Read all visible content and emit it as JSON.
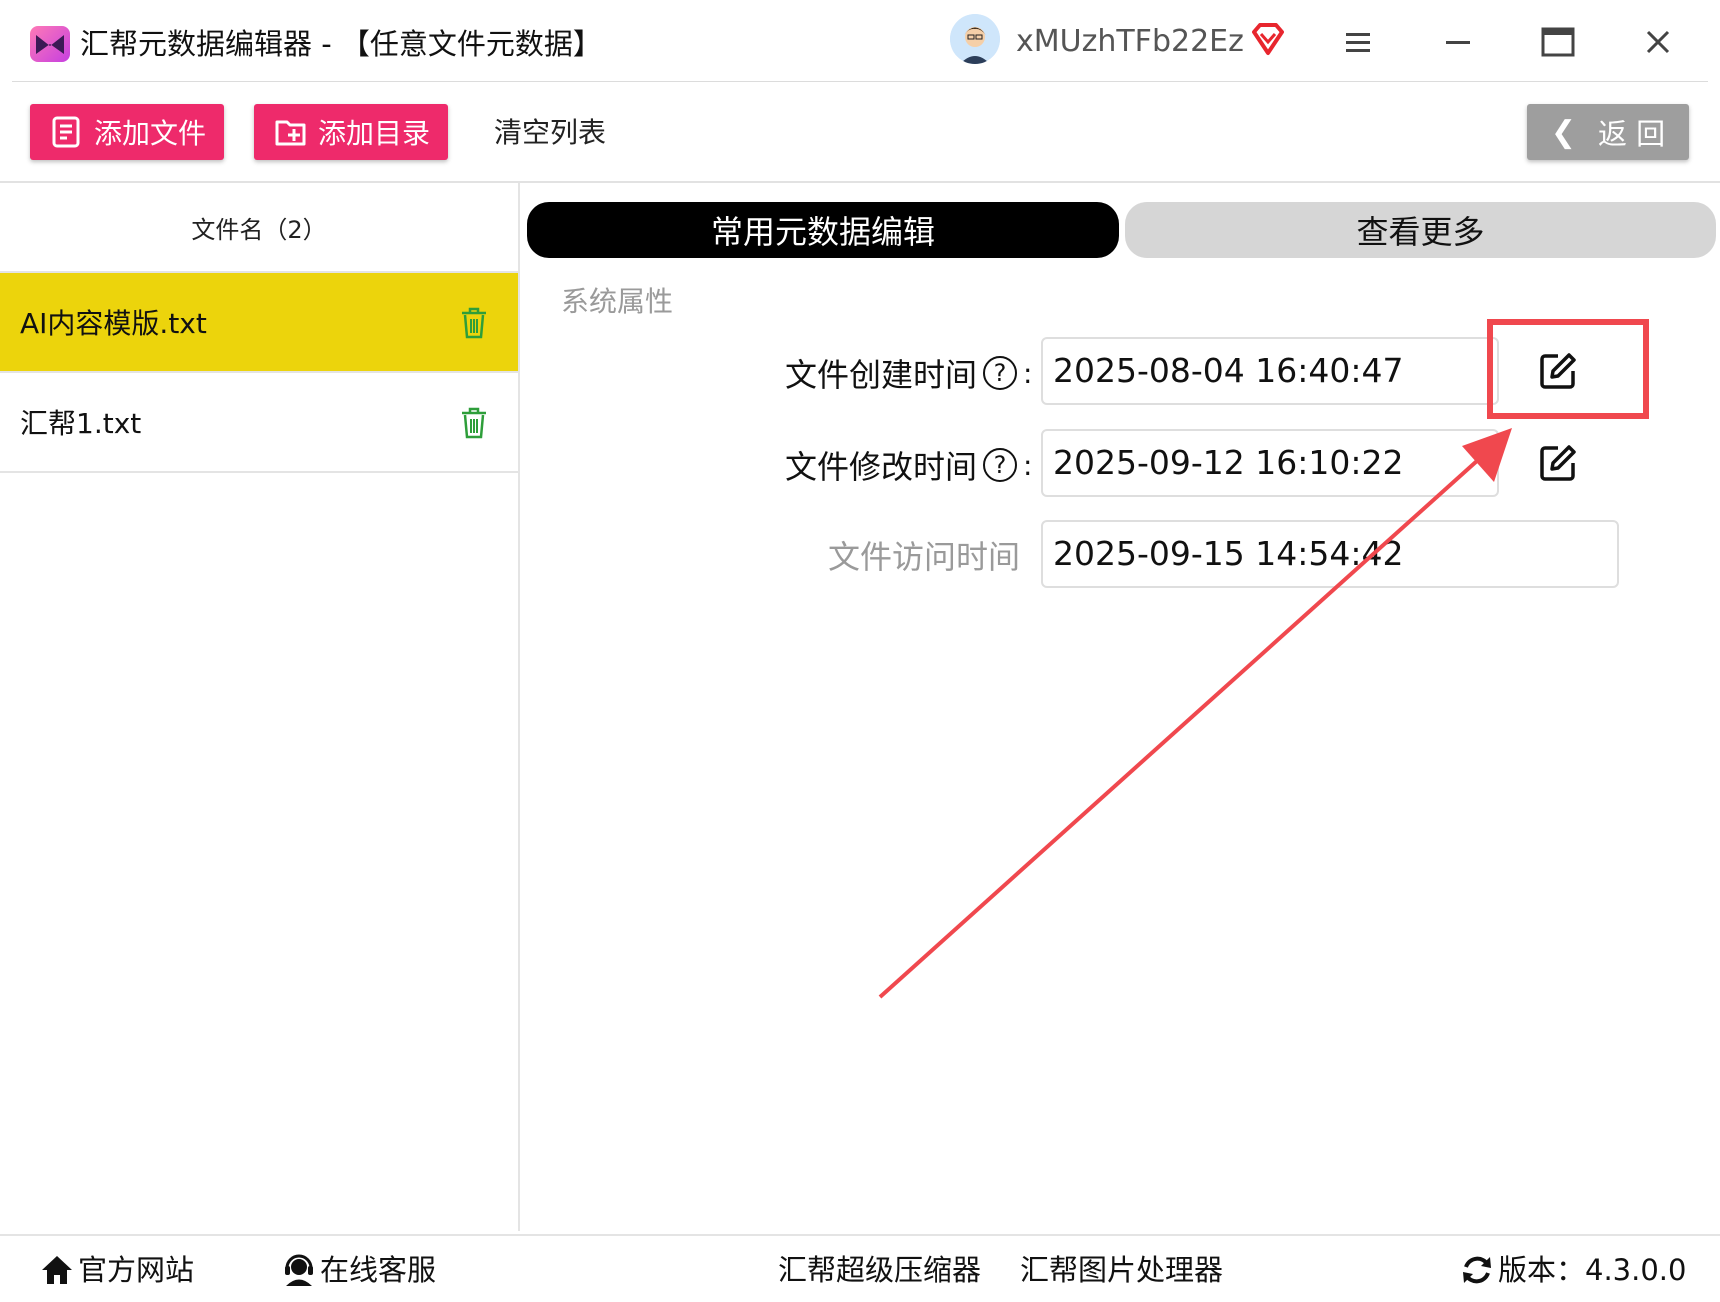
{
  "window": {
    "title": "汇帮元数据编辑器 - 【任意文件元数据】",
    "username": "xMUzhTFb22Ez"
  },
  "toolbar": {
    "add_file": "添加文件",
    "add_dir": "添加目录",
    "clear_list": "清空列表",
    "back": "返 回"
  },
  "file_list": {
    "header": "文件名（2）",
    "files": [
      {
        "name": "AI内容模版.txt",
        "selected": true
      },
      {
        "name": "汇帮1.txt",
        "selected": false
      }
    ]
  },
  "tabs": {
    "common": "常用元数据编辑",
    "more": "查看更多"
  },
  "properties": {
    "section": "系统属性",
    "created_label": "文件创建时间",
    "created_value": "2025-08-04 16:40:47",
    "modified_label": "文件修改时间",
    "modified_value": "2025-09-12 16:10:22",
    "accessed_label": "文件访问时间",
    "accessed_value": "2025-09-15 14:54:42",
    "help_glyph": "?",
    "colon": ":"
  },
  "status": {
    "website": "官方网站",
    "support": "在线客服",
    "compressor": "汇帮超级压缩器",
    "image_tool": "汇帮图片处理器",
    "version": "版本：4.3.0.0"
  },
  "colors": {
    "accent_pink": "#ee2a6b",
    "selected_row": "#ecd40c",
    "annotation_red": "#f0484e",
    "trash_green": "#2e9e3a"
  },
  "icons": [
    "app-logo-icon",
    "avatar-icon",
    "vip-diamond-icon",
    "menu-icon",
    "minimize-icon",
    "maximize-icon",
    "close-icon",
    "add-file-icon",
    "add-folder-icon",
    "trash-icon",
    "help-icon",
    "edit-icon",
    "home-icon",
    "headset-icon",
    "refresh-icon"
  ]
}
